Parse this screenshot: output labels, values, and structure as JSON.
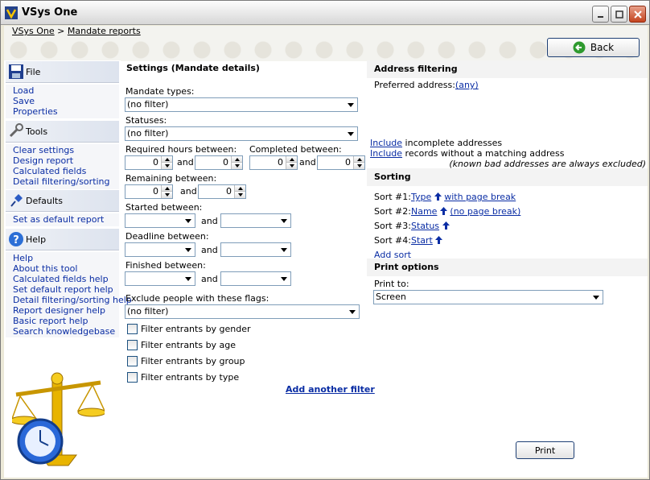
{
  "window": {
    "title": "VSys One"
  },
  "breadcrumb": {
    "root": "VSys One",
    "separator": ">",
    "current": "Mandate reports"
  },
  "back_label": "Back",
  "sidebar": {
    "file": {
      "title": "File",
      "items": [
        "Load",
        "Save",
        "Properties"
      ]
    },
    "tools": {
      "title": "Tools",
      "items": [
        "Clear settings",
        "Design report",
        "Calculated fields",
        "Detail filtering/sorting"
      ]
    },
    "defaults": {
      "title": "Defaults",
      "items": [
        "Set as default report"
      ]
    },
    "help": {
      "title": "Help",
      "items": [
        "Help",
        "About this tool",
        "Calculated fields help",
        "Set default report help",
        "Detail filtering/sorting help",
        "Report designer help",
        "Basic report help",
        "Search knowledgebase"
      ]
    }
  },
  "settings": {
    "title": "Settings (Mandate details)",
    "mandate_types_label": "Mandate types:",
    "mandate_types_value": "(no filter)",
    "statuses_label": "Statuses:",
    "statuses_value": "(no filter)",
    "required_hours_label": "Required hours between:",
    "completed_label": "Completed between:",
    "remaining_label": "Remaining between:",
    "started_label": "Started between:",
    "deadline_label": "Deadline between:",
    "finished_label": "Finished between:",
    "and": "and",
    "zero": "0",
    "exclude_flags_label": "Exclude people with these flags:",
    "exclude_flags_value": "(no filter)",
    "filters": [
      "Filter entrants by gender",
      "Filter entrants by age",
      "Filter entrants by group",
      "Filter entrants by type"
    ],
    "add_filter": "Add another filter"
  },
  "address": {
    "title": "Address filtering",
    "preferred_label": "Preferred address:",
    "preferred_value": "(any)",
    "include_word": "Include",
    "incomplete_text": " incomplete addresses",
    "nomatch_text": " records without a matching address",
    "note": "(known bad addresses are always excluded)"
  },
  "sorting": {
    "title": "Sorting",
    "sorts": [
      {
        "label": "Sort #1:",
        "field": "Type",
        "pagebreak": "with page break"
      },
      {
        "label": "Sort #2:",
        "field": "Name",
        "pagebreak": "(no page break)"
      },
      {
        "label": "Sort #3:",
        "field": "Status",
        "pagebreak": ""
      },
      {
        "label": "Sort #4:",
        "field": "Start",
        "pagebreak": ""
      }
    ],
    "add_sort": "Add sort"
  },
  "print": {
    "title": "Print options",
    "print_to_label": "Print to:",
    "print_to_value": "Screen",
    "print_button": "Print"
  }
}
